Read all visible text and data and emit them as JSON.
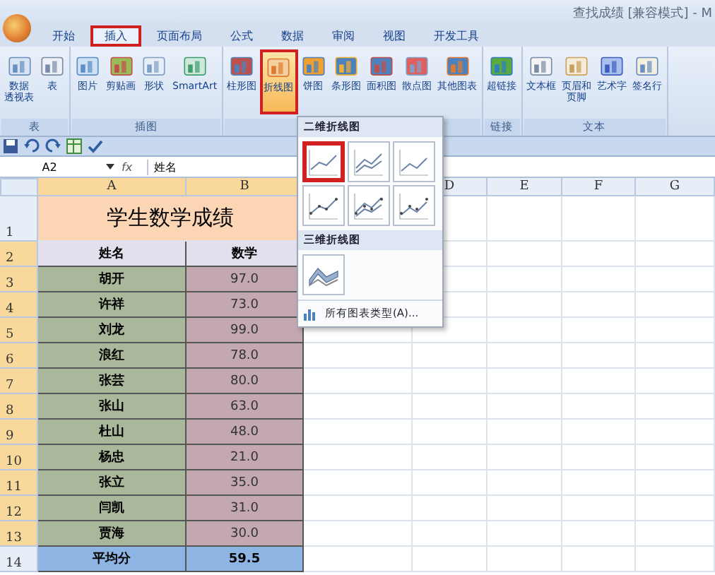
{
  "window": {
    "title": "查找成绩 [兼容模式] - M"
  },
  "tabs": [
    {
      "label": "开始",
      "selected": false
    },
    {
      "label": "插入",
      "selected": true
    },
    {
      "label": "页面布局",
      "selected": false
    },
    {
      "label": "公式",
      "selected": false
    },
    {
      "label": "数据",
      "selected": false
    },
    {
      "label": "审阅",
      "selected": false
    },
    {
      "label": "视图",
      "selected": false
    },
    {
      "label": "开发工具",
      "selected": false
    }
  ],
  "ribbon_groups": [
    {
      "label": "表",
      "buttons": [
        {
          "lines": [
            "数据",
            "透视表"
          ],
          "pressed": false
        },
        {
          "lines": [
            "表"
          ],
          "pressed": false
        }
      ]
    },
    {
      "label": "插图",
      "buttons": [
        {
          "lines": [
            "图片"
          ],
          "pressed": false
        },
        {
          "lines": [
            "剪贴画"
          ],
          "pressed": false
        },
        {
          "lines": [
            "形状"
          ],
          "pressed": false
        },
        {
          "lines": [
            "SmartArt"
          ],
          "pressed": false
        }
      ]
    },
    {
      "buttons": [
        {
          "lines": [
            "柱形图"
          ],
          "pressed": false
        },
        {
          "lines": [
            "折线图"
          ],
          "pressed": true
        },
        {
          "lines": [
            "饼图"
          ],
          "pressed": false
        },
        {
          "lines": [
            "条形图"
          ],
          "pressed": false
        },
        {
          "lines": [
            "面积图"
          ],
          "pressed": false
        },
        {
          "lines": [
            "散点图"
          ],
          "pressed": false
        },
        {
          "lines": [
            "其他图表"
          ],
          "pressed": false
        }
      ]
    },
    {
      "label": "链接",
      "buttons": [
        {
          "lines": [
            "超链接"
          ],
          "pressed": false
        }
      ]
    },
    {
      "label": "文本",
      "buttons": [
        {
          "lines": [
            "文本框"
          ],
          "pressed": false
        },
        {
          "lines": [
            "页眉和",
            "页脚"
          ],
          "pressed": false
        },
        {
          "lines": [
            "艺术字"
          ],
          "pressed": false
        },
        {
          "lines": [
            "签名行"
          ],
          "pressed": false
        }
      ]
    }
  ],
  "formula_bar": {
    "name_box": "A2",
    "fx_label": "fx",
    "value": "姓名"
  },
  "columns": [
    {
      "label": "A",
      "selected": true
    },
    {
      "label": "B",
      "selected": true
    },
    {
      "label": "D",
      "selected": false
    },
    {
      "label": "E",
      "selected": false
    },
    {
      "label": "F",
      "selected": false
    },
    {
      "label": "G",
      "selected": false
    }
  ],
  "rows": [
    {
      "number": "1",
      "kind": "title",
      "selected": false,
      "cells": [
        "学生数学成绩"
      ]
    },
    {
      "number": "2",
      "kind": "header",
      "selected": true,
      "cells": [
        "姓名",
        "数学"
      ]
    },
    {
      "number": "3",
      "kind": "data",
      "selected": true,
      "cells": [
        "胡开",
        "97.0"
      ]
    },
    {
      "number": "4",
      "kind": "data",
      "selected": true,
      "cells": [
        "许祥",
        "73.0"
      ]
    },
    {
      "number": "5",
      "kind": "data",
      "selected": true,
      "cells": [
        "刘龙",
        "99.0"
      ]
    },
    {
      "number": "6",
      "kind": "data",
      "selected": true,
      "cells": [
        "浪红",
        "78.0"
      ]
    },
    {
      "number": "7",
      "kind": "data",
      "selected": true,
      "cells": [
        "张芸",
        "80.0"
      ]
    },
    {
      "number": "8",
      "kind": "data",
      "selected": true,
      "cells": [
        "张山",
        "63.0"
      ]
    },
    {
      "number": "9",
      "kind": "data",
      "selected": true,
      "cells": [
        "杜山",
        "48.0"
      ]
    },
    {
      "number": "10",
      "kind": "data",
      "selected": true,
      "cells": [
        "杨忠",
        "21.0"
      ]
    },
    {
      "number": "11",
      "kind": "data",
      "selected": true,
      "cells": [
        "张立",
        "35.0"
      ]
    },
    {
      "number": "12",
      "kind": "data",
      "selected": true,
      "cells": [
        "闫凯",
        "31.0"
      ]
    },
    {
      "number": "13",
      "kind": "data",
      "selected": true,
      "cells": [
        "贾海",
        "30.0"
      ]
    },
    {
      "number": "14",
      "kind": "total",
      "selected": false,
      "cells": [
        "平均分",
        "59.5"
      ]
    }
  ],
  "dropdown": {
    "sections": [
      {
        "title": "二维折线图",
        "items": [
          {
            "selected": true
          },
          {
            "selected": false
          },
          {
            "selected": false
          },
          {
            "selected": false
          },
          {
            "selected": false
          },
          {
            "selected": false
          }
        ]
      },
      {
        "title": "三维折线图",
        "items": [
          {
            "selected": false
          }
        ]
      }
    ],
    "footer": "所有图表类型(A)..."
  }
}
